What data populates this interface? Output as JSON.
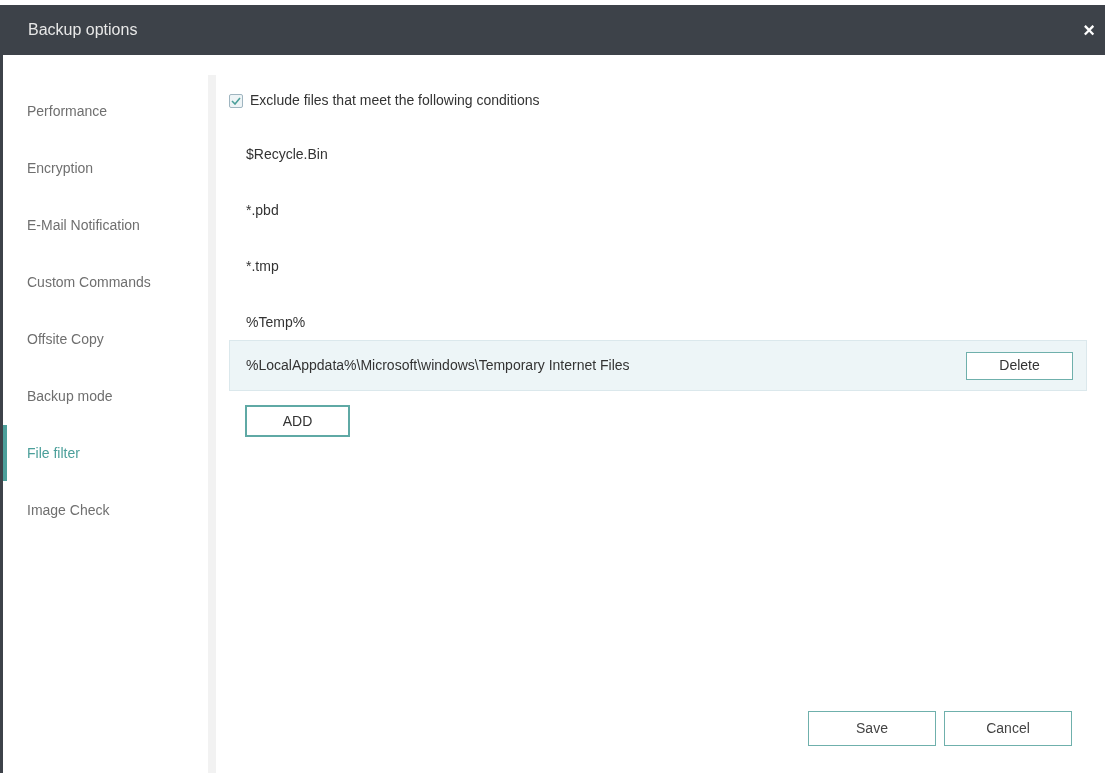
{
  "window": {
    "title": "Backup options",
    "close": "×"
  },
  "sidebar": {
    "items": [
      {
        "label": "Performance",
        "selected": false
      },
      {
        "label": "Encryption",
        "selected": false
      },
      {
        "label": "E-Mail Notification",
        "selected": false
      },
      {
        "label": "Custom Commands",
        "selected": false
      },
      {
        "label": "Offsite Copy",
        "selected": false
      },
      {
        "label": "Backup mode",
        "selected": false
      },
      {
        "label": "File filter",
        "selected": true
      },
      {
        "label": "Image Check",
        "selected": false
      }
    ]
  },
  "exclude": {
    "label": "Exclude files that meet the following conditions",
    "checked": true
  },
  "conditions": [
    {
      "text": "$Recycle.Bin",
      "selected": false
    },
    {
      "text": "*.pbd",
      "selected": false
    },
    {
      "text": "*.tmp",
      "selected": false
    },
    {
      "text": "%Temp%",
      "selected": false
    },
    {
      "text": "%LocalAppdata%\\Microsoft\\windows\\Temporary Internet Files",
      "selected": true
    }
  ],
  "delete_button": "Delete",
  "add_button": "ADD",
  "buttons": [
    "Save",
    "Cancel"
  ]
}
